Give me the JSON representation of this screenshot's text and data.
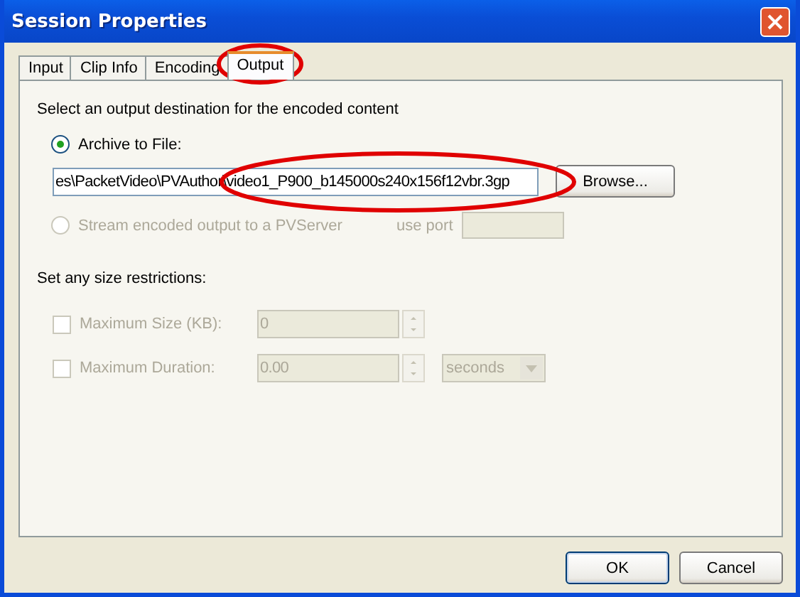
{
  "window": {
    "title": "Session Properties"
  },
  "tabs": [
    {
      "label": "Input",
      "selected": false,
      "circled": false
    },
    {
      "label": "Clip Info",
      "selected": false,
      "circled": false
    },
    {
      "label": "Encoding",
      "selected": false,
      "circled": false
    },
    {
      "label": "Output",
      "selected": true,
      "circled": true
    }
  ],
  "output": {
    "heading": "Select an output destination for the encoded content",
    "destinations": [
      {
        "kind": "file",
        "label": "Archive to File:",
        "selected": true,
        "disabled": false,
        "value": "es\\PacketVideo\\PVAuthor\\video1_P900_b145000s240x156f12vbr.3gp",
        "circled": true,
        "button": "Browse..."
      },
      {
        "kind": "stream",
        "label": "Stream encoded output to a PVServer",
        "selected": false,
        "disabled": true,
        "port_label": "use port"
      }
    ]
  },
  "restrictions": {
    "heading": "Set any size restrictions:",
    "items": [
      {
        "kind": "spin",
        "label": "Maximum Size (KB):",
        "checked": false,
        "disabled": true,
        "value": "0"
      },
      {
        "kind": "spin_unit",
        "label": "Maximum Duration:",
        "checked": false,
        "disabled": true,
        "value": "0.00",
        "unit": "seconds"
      }
    ]
  },
  "buttons": [
    {
      "label": "OK",
      "default": true
    },
    {
      "label": "Cancel",
      "default": false
    }
  ]
}
